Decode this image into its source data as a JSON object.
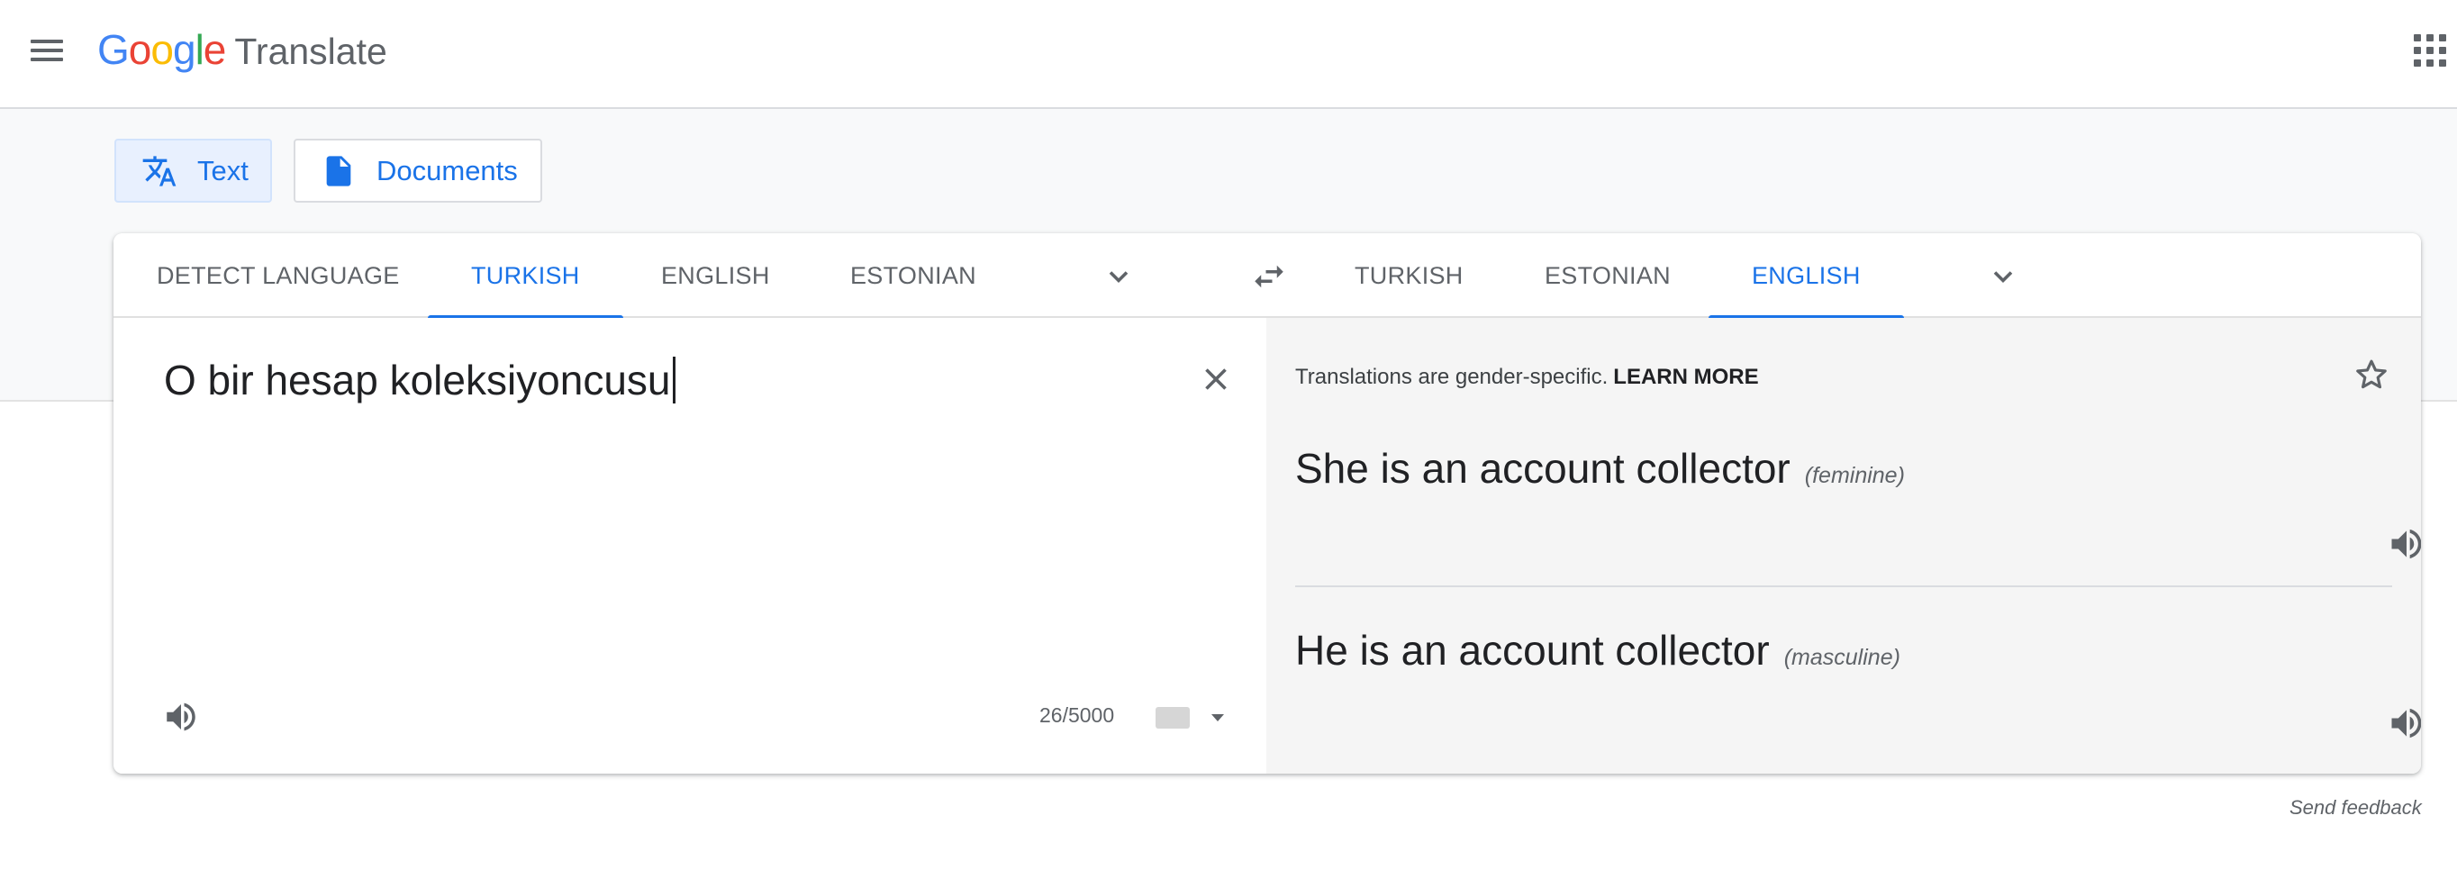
{
  "header": {
    "menu_icon": "hamburger-menu-icon",
    "logo_letters": [
      {
        "ch": "G",
        "color": "#4285F4"
      },
      {
        "ch": "o",
        "color": "#EA4335"
      },
      {
        "ch": "o",
        "color": "#FBBC05"
      },
      {
        "ch": "g",
        "color": "#4285F4"
      },
      {
        "ch": "l",
        "color": "#34A853"
      },
      {
        "ch": "e",
        "color": "#EA4335"
      }
    ],
    "product": "Translate",
    "apps_icon": "apps-grid-icon"
  },
  "modes": {
    "text_label": "Text",
    "documents_label": "Documents"
  },
  "source_languages": [
    "DETECT LANGUAGE",
    "TURKISH",
    "ENGLISH",
    "ESTONIAN"
  ],
  "target_languages": [
    "TURKISH",
    "ESTONIAN",
    "ENGLISH"
  ],
  "selected_source": "TURKISH",
  "selected_target": "ENGLISH",
  "source": {
    "text": "O bir hesap koleksiyoncusu",
    "char_count": "26/5000"
  },
  "target": {
    "notice": "Translations are gender-specific.",
    "learn_more": "LEARN MORE",
    "translations": [
      {
        "text": "She is an account collector",
        "gender": "(feminine)"
      },
      {
        "text": "He is an account collector",
        "gender": "(masculine)"
      }
    ]
  },
  "feedback": "Send feedback",
  "colors": {
    "accent": "#1a73e8",
    "active_mode_bg": "#e8f0fe",
    "target_panel_bg": "#f5f5f5"
  }
}
